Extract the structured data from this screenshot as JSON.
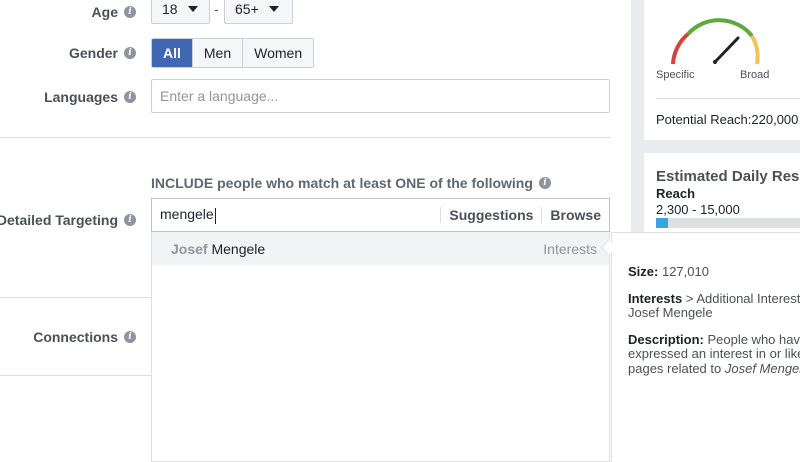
{
  "form": {
    "age": {
      "label": "Age",
      "min": "18",
      "separator": "-",
      "max": "65+"
    },
    "gender": {
      "label": "Gender",
      "options": [
        "All",
        "Men",
        "Women"
      ],
      "selected": "All"
    },
    "languages": {
      "label": "Languages",
      "placeholder": "Enter a language..."
    },
    "detailed_targeting": {
      "label": "Detailed Targeting",
      "include_text": "INCLUDE people who match at least ONE of the following",
      "query": "mengele",
      "suggestions_label": "Suggestions",
      "browse_label": "Browse",
      "results": [
        {
          "first": "Josef",
          "last": "Mengele",
          "category": "Interests"
        }
      ]
    },
    "connections": {
      "label": "Connections"
    },
    "info_icon": "i"
  },
  "sidebar": {
    "gauge": {
      "left_label": "Specific",
      "right_label": "Broad"
    },
    "potential_reach": "Potential Reach:220,000",
    "estimated_title": "Estimated Daily Results",
    "reach_label": "Reach",
    "reach_range": "2,300 - 15,000",
    "reach_bar_fraction": 0.08
  },
  "tooltip": {
    "size_label": "Size:",
    "size_value": "127,010",
    "path_label": "Interests",
    "path_rest": "> Additional Interests >",
    "path_line2": "Josef Mengele",
    "desc_label": "Description:",
    "desc_line1": "People who have",
    "desc_line2": "expressed an interest in or like",
    "desc_line3_pre": "pages related to ",
    "desc_line3_em": "Josef Mengele"
  },
  "colors": {
    "accent": "#4267b2",
    "bar": "#3ea3dc",
    "gauge_red": "#d4423a",
    "gauge_green": "#5fa83f",
    "gauge_yellow": "#f0c45a"
  }
}
